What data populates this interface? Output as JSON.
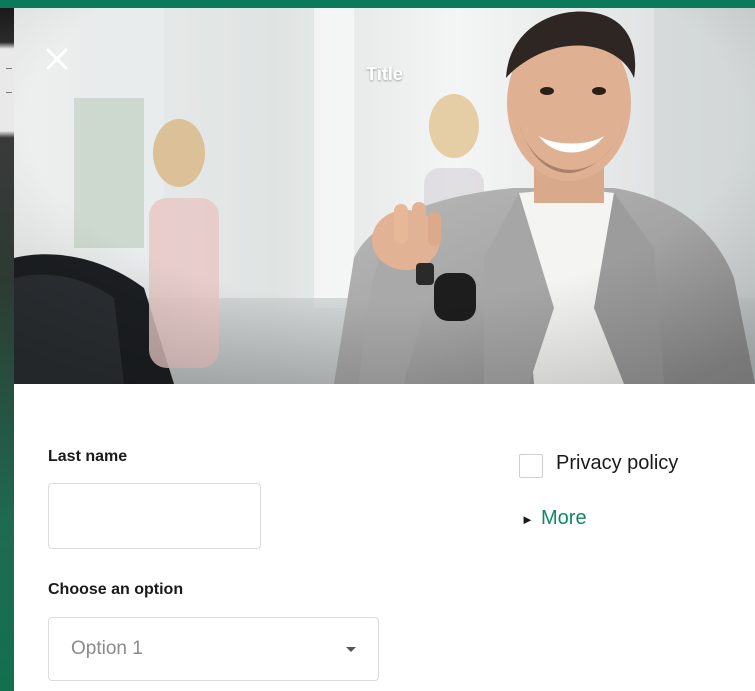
{
  "colors": {
    "brand_green": "#0b7a5a",
    "link_green": "#0f8a5f",
    "input_border": "#dcdcdc",
    "placeholder_text": "#8a8a8a"
  },
  "header": {
    "title": "Title",
    "close_icon": "close-icon"
  },
  "form": {
    "last_name": {
      "label": "Last name",
      "value": "",
      "placeholder": ""
    },
    "choose_option": {
      "label": "Choose an option",
      "selected": "Option 1",
      "caret_icon": "caret-down-icon"
    },
    "privacy": {
      "label": "Privacy policy",
      "checked": false
    },
    "more": {
      "arrow": "►",
      "label": "More"
    }
  }
}
